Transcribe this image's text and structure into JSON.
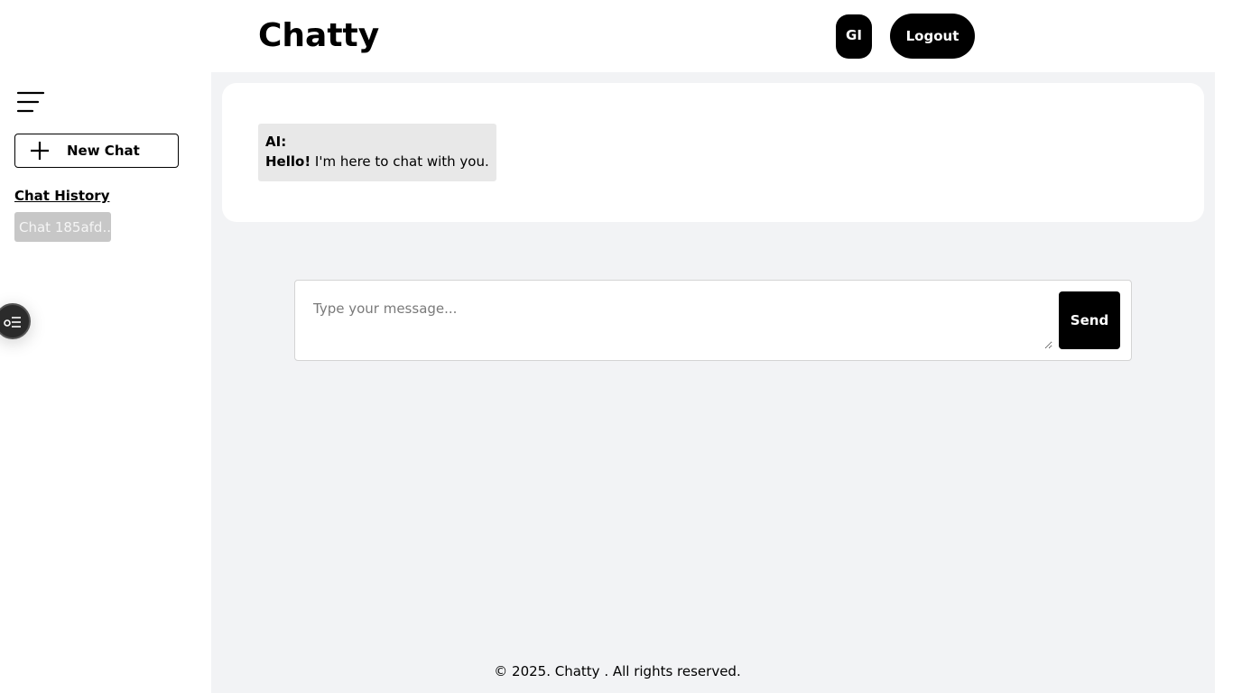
{
  "header": {
    "title": "Chatty",
    "avatar_initials": "GI",
    "logout_label": "Logout"
  },
  "sidebar": {
    "menu_icon": "hamburger-menu-icon",
    "new_chat_icon": "plus-icon",
    "new_chat_label": "New Chat",
    "history_title": "Chat History",
    "history_items": [
      {
        "label": "Chat 185afd..."
      }
    ],
    "float_toggle_icon": "settings-list-icon"
  },
  "chat": {
    "messages": [
      {
        "sender": "AI:",
        "greeting": "Hello!",
        "text": " I'm here to chat with you."
      }
    ]
  },
  "composer": {
    "placeholder": "Type your message...",
    "value": "",
    "send_label": "Send"
  },
  "footer": {
    "text": "© 2025. Chatty . All rights reserved."
  },
  "colors": {
    "primary": "#000000",
    "main_background": "#f2f3f5",
    "message_bubble": "#e8e8e8",
    "history_item_bg": "#c7c7c7"
  }
}
